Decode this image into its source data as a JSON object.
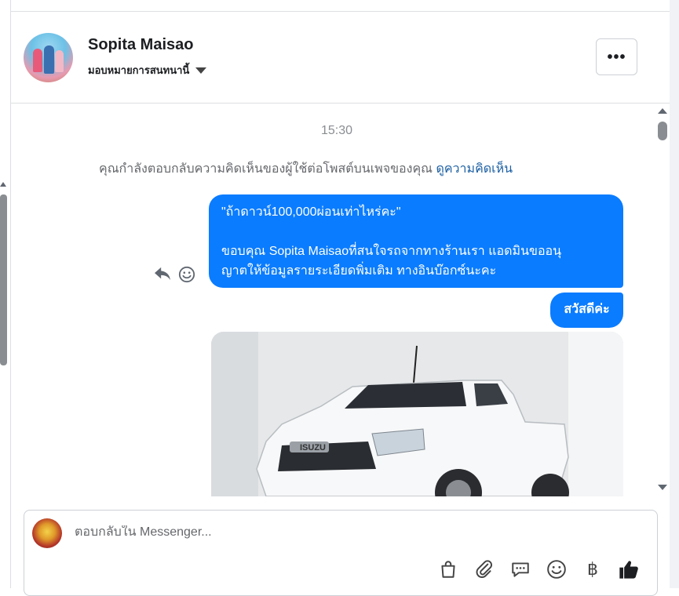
{
  "header": {
    "contact_name": "Sopita Maisao",
    "assign_label": "มอบหมายการสนทนานี้",
    "more_label": "•••"
  },
  "thread": {
    "timestamp": "15:30",
    "context_text": "คุณกำลังตอบกลับความคิดเห็นของผู้ใช้ต่อโพสต์บนเพจของคุณ",
    "context_link": "ดูความคิดเห็น",
    "messages": [
      {
        "line1": "\"ถ้าดาวน์100,000ผ่อนเท่าไหร่คะ\"",
        "line2": "ขอบคุณ Sopita Maisaoที่สนใจรถจากทางร้านเรา แอดมินขออนุ",
        "line3": "ญาตให้ข้อมูลรายระเอียดพิ่มเติม ทางอินบ๊อกซ์นะคะ"
      },
      {
        "text": "สวัสดีค่ะ"
      }
    ],
    "photo_badge": "ISUZU"
  },
  "composer": {
    "placeholder": "ตอบกลับใน Messenger..."
  },
  "tools": {
    "baht_symbol": "฿"
  },
  "colors": {
    "bubble": "#0a7cff",
    "link": "#1b5fa3",
    "like": "#1c1e21"
  }
}
